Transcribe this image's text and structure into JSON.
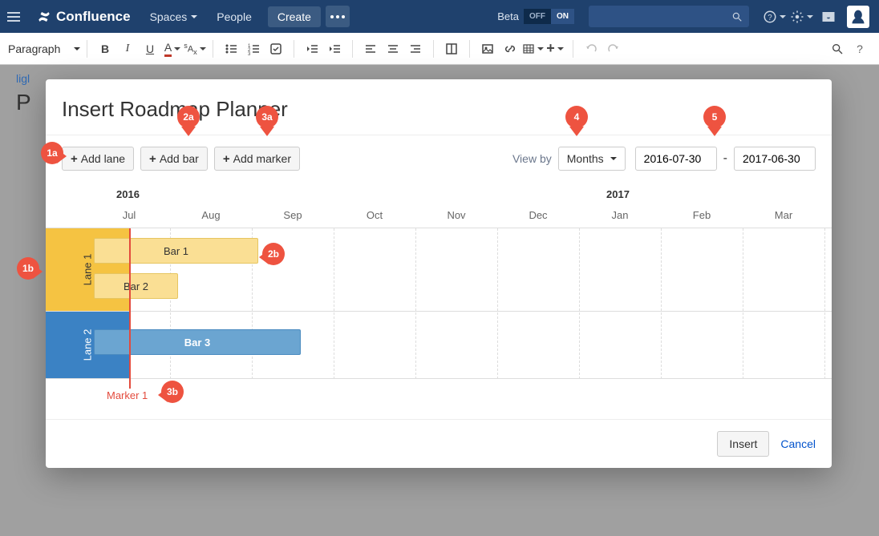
{
  "header": {
    "app_name": "Confluence",
    "nav": {
      "spaces": "Spaces",
      "people": "People",
      "create": "Create"
    },
    "beta": "Beta",
    "toggle": {
      "off": "OFF",
      "on": "ON"
    }
  },
  "toolbar": {
    "paragraph": "Paragraph"
  },
  "page": {
    "breadcrumb": "ligl",
    "title": "P"
  },
  "modal": {
    "title": "Insert Roadmap Planner",
    "add_lane": "Add lane",
    "add_bar": "Add bar",
    "add_marker": "Add marker",
    "view_by_label": "View by",
    "view_by_value": "Months",
    "date_from": "2016-07-30",
    "date_sep": "-",
    "date_to": "2017-06-30",
    "insert": "Insert",
    "cancel": "Cancel"
  },
  "timeline": {
    "years": [
      "2016",
      "2017"
    ],
    "months": [
      "Jul",
      "Aug",
      "Sep",
      "Oct",
      "Nov",
      "Dec",
      "Jan",
      "Feb",
      "Mar"
    ],
    "lanes": [
      {
        "name": "Lane 1",
        "bars": [
          {
            "label": "Bar 1"
          },
          {
            "label": "Bar 2"
          }
        ]
      },
      {
        "name": "Lane 2",
        "bars": [
          {
            "label": "Bar 3"
          }
        ]
      }
    ],
    "marker": "Marker 1"
  },
  "annotations": {
    "a1a": "1a",
    "a2a": "2a",
    "a3a": "3a",
    "a1b": "1b",
    "a2b": "2b",
    "a3b": "3b",
    "a4": "4",
    "a5": "5"
  }
}
